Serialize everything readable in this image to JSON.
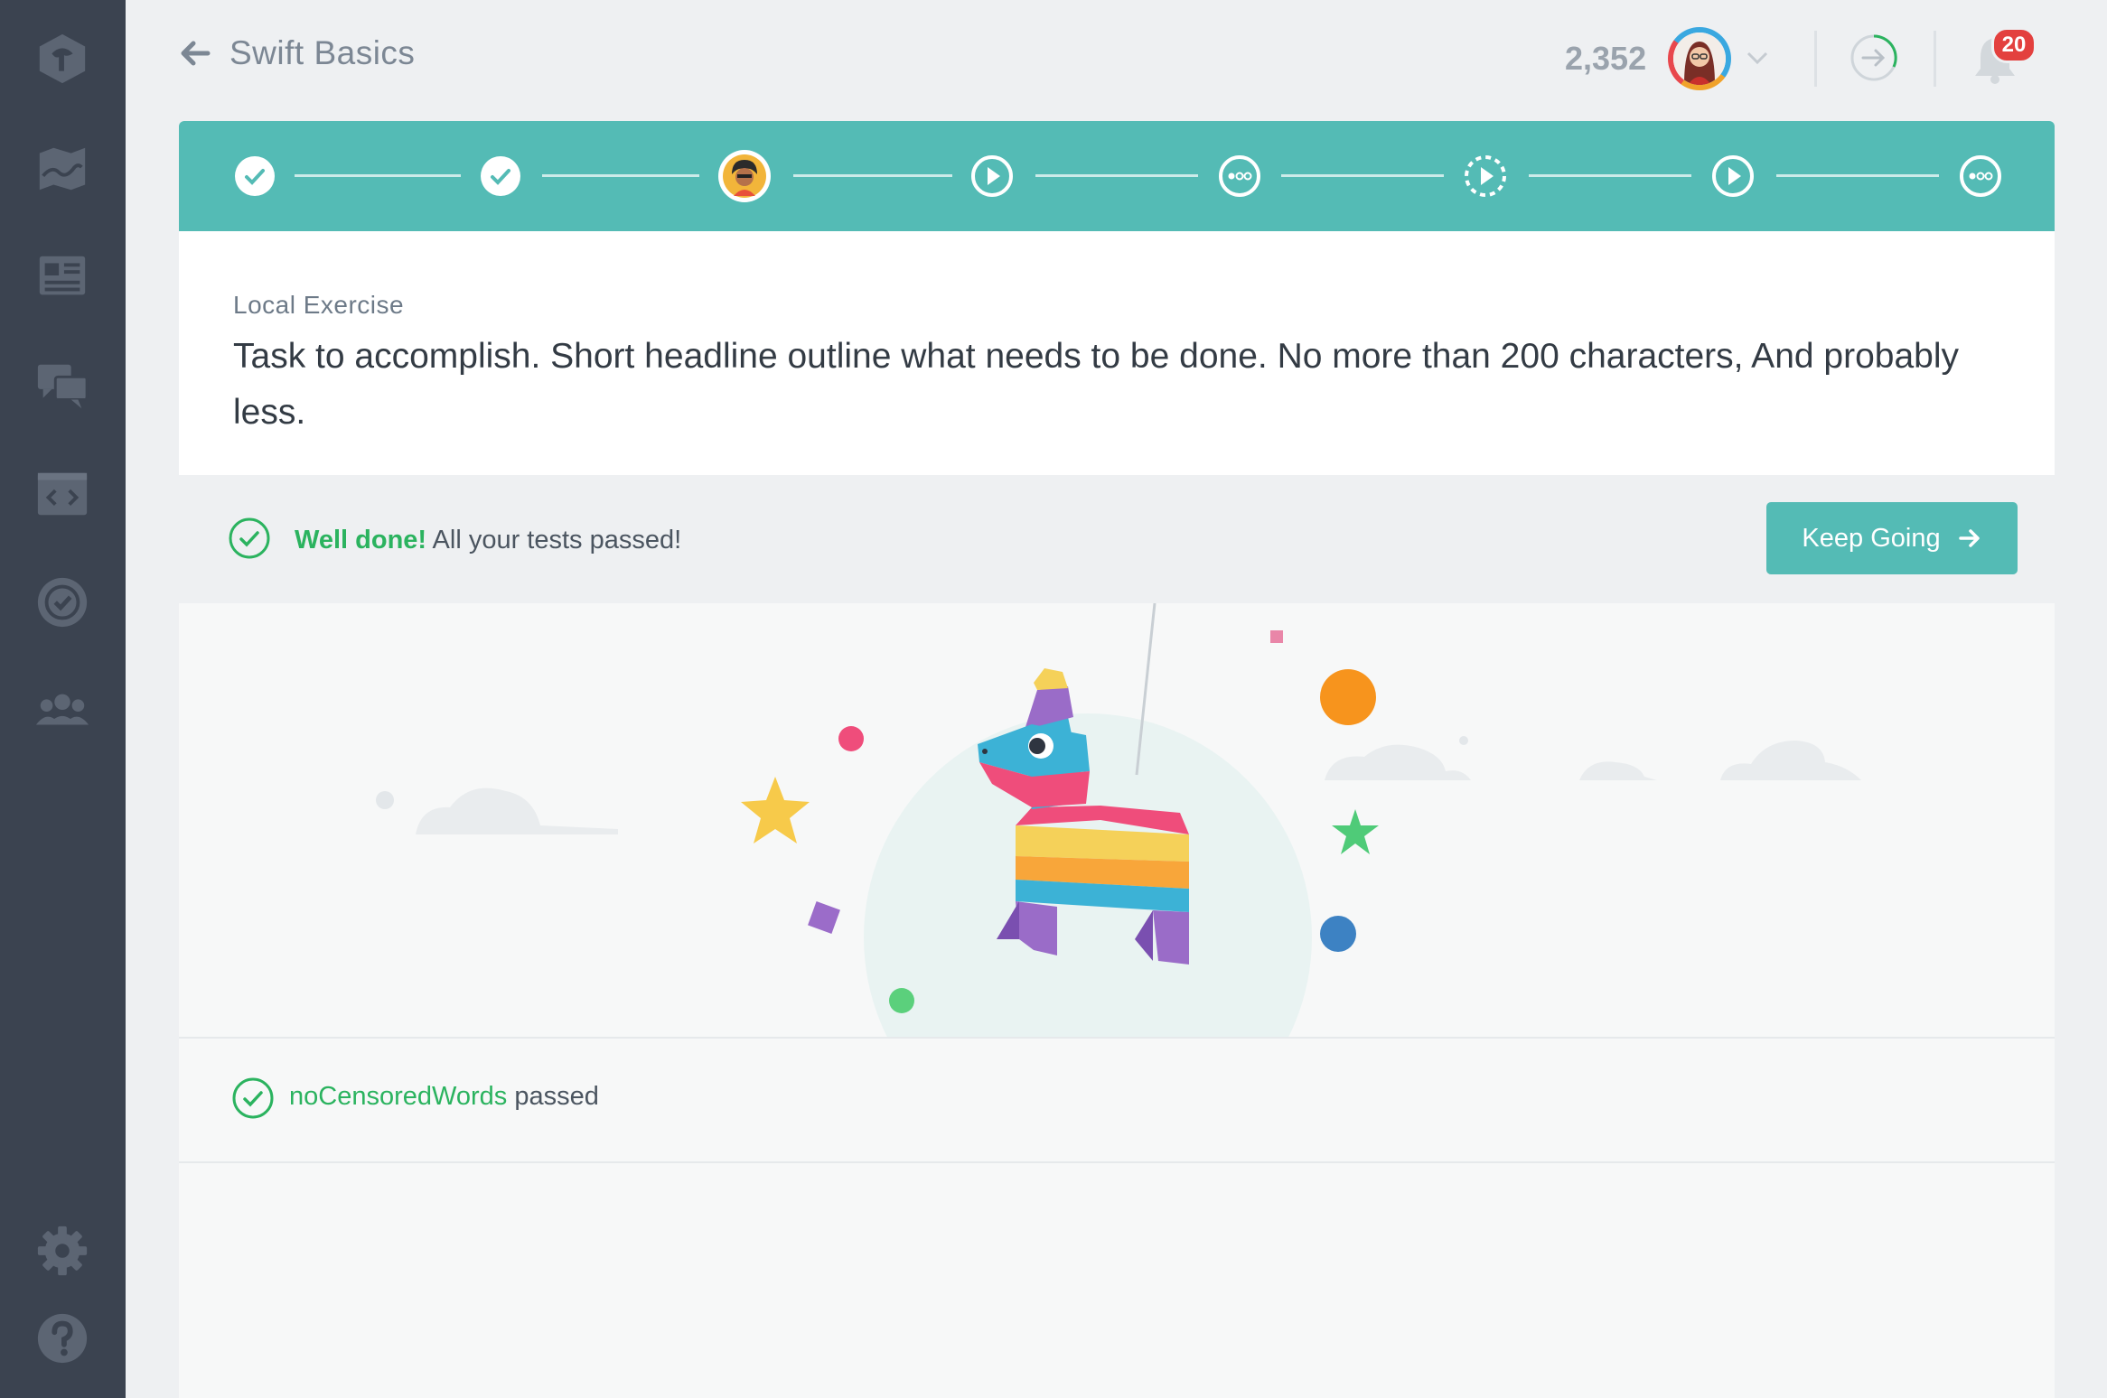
{
  "sidebar": {
    "items": [
      {
        "icon": "treehouse-logo-icon"
      },
      {
        "icon": "map-icon"
      },
      {
        "icon": "library-icon"
      },
      {
        "icon": "community-chat-icon"
      },
      {
        "icon": "workspaces-code-icon"
      },
      {
        "icon": "badge-check-icon"
      },
      {
        "icon": "team-icon"
      },
      {
        "icon": "settings-gear-icon"
      },
      {
        "icon": "help-question-icon"
      }
    ]
  },
  "header": {
    "course_title": "Swift Basics",
    "points": "2,352",
    "notification_count": "20"
  },
  "stepper": {
    "steps": [
      {
        "state": "completed"
      },
      {
        "state": "completed"
      },
      {
        "state": "current"
      },
      {
        "state": "video"
      },
      {
        "state": "quiz"
      },
      {
        "state": "video-locked"
      },
      {
        "state": "video"
      },
      {
        "state": "quiz"
      }
    ]
  },
  "task": {
    "label": "Local Exercise",
    "text": "Task to accomplish. Short headline outline what needs to be done. No more than 200 characters, And probably less."
  },
  "result": {
    "strong": "Well done!",
    "message": " All your tests passed!",
    "button_label": "Keep Going"
  },
  "tests": [
    {
      "name": "noCensoredWords",
      "status": " passed"
    }
  ],
  "colors": {
    "sidebar": "#3b4350",
    "accent": "#54bbb5",
    "success": "#2bb35f",
    "badge": "#e3403e"
  }
}
